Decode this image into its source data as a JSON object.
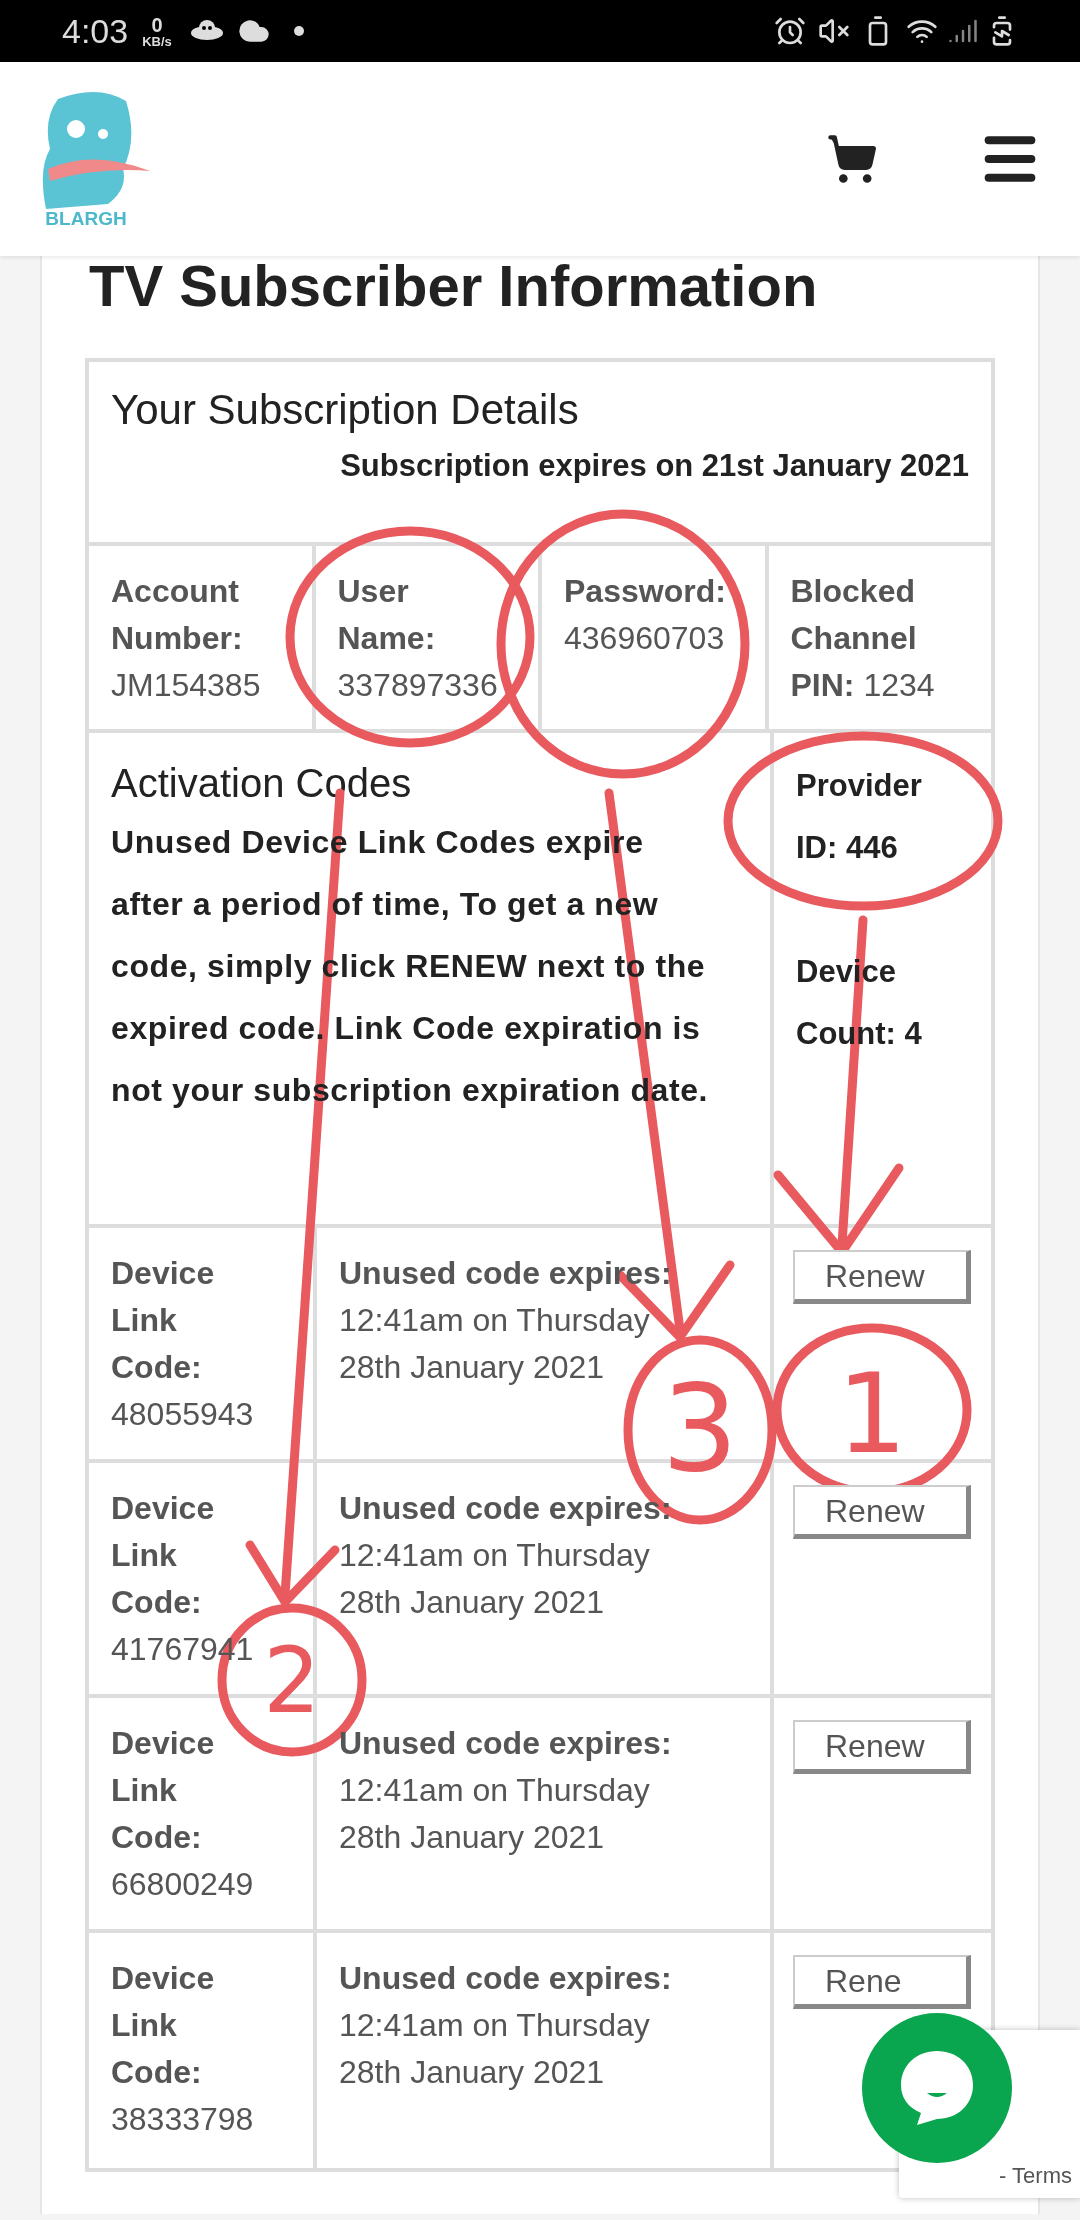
{
  "status_bar": {
    "time": "4:03",
    "net_speed_value": "0",
    "net_speed_unit": "KB/s"
  },
  "header": {
    "logo_text": "BLARGH"
  },
  "page_title": "TV Subscriber Information",
  "details": {
    "heading": "Your Subscription Details",
    "expiry": "Subscription expires on 21st January 2021"
  },
  "fields": [
    {
      "kind": "stacked",
      "label": "Account Number:",
      "value": "JM154385"
    },
    {
      "kind": "stacked",
      "label": "User Name:",
      "value": "337897336"
    },
    {
      "kind": "stacked",
      "label": "Password:",
      "value": "436960703"
    },
    {
      "kind": "inline",
      "label": "Blocked Channel PIN:",
      "value": "1234"
    }
  ],
  "activation": {
    "heading": "Activation Codes",
    "note": "Unused Device Link Codes expire after a period of time, To get a new code, simply click RENEW next to the expired code. Link Code expiration is not your subscription expiration date.",
    "provider": "Provider ID: 446",
    "device_count": "Device Count: 4"
  },
  "codes": [
    {
      "label": "Device Link Code:",
      "code": "48055943",
      "expires_label": "Unused code expires:",
      "expires": "12:41am on Thursday 28th January 2021",
      "button": "Renew"
    },
    {
      "label": "Device Link Code:",
      "code": "41767941",
      "expires_label": "Unused code expires:",
      "expires": "12:41am on Thursday 28th January 2021",
      "button": "Renew"
    },
    {
      "label": "Device Link Code:",
      "code": "66800249",
      "expires_label": "Unused code expires:",
      "expires": "12:41am on Thursday 28th January 2021",
      "button": "Renew"
    },
    {
      "label": "Device Link Code:",
      "code": "38333798",
      "expires_label": "Unused code expires:",
      "expires": "12:41am on Thursday 28th January 2021",
      "button": "Rene"
    }
  ],
  "annotations": [
    {
      "label": "1"
    },
    {
      "label": "2"
    },
    {
      "label": "3"
    }
  ],
  "recaptcha": {
    "text": "- Terms"
  }
}
